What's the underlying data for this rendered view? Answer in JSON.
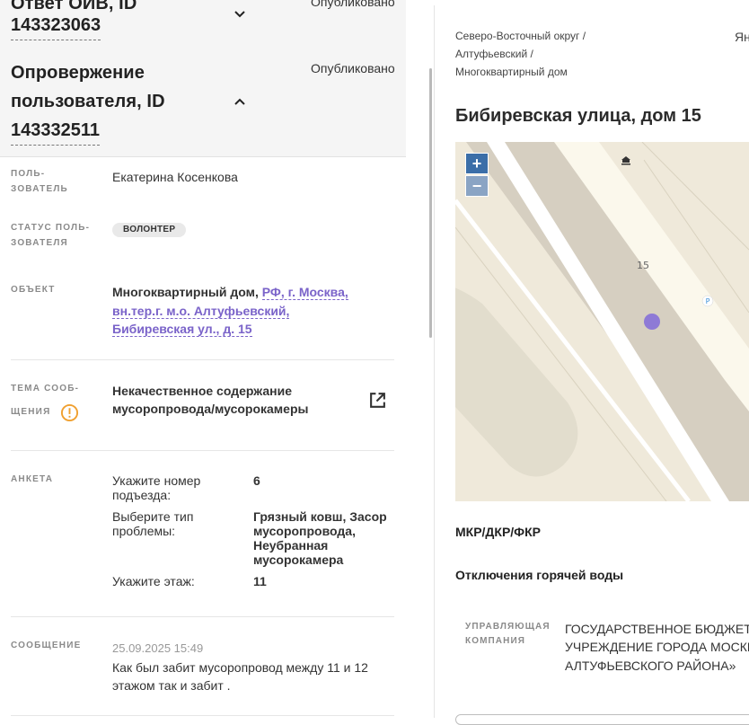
{
  "header": {
    "prev_title": "Ответ ОИВ, ID",
    "prev_id": "143323063",
    "prev_status": "Опубликовано",
    "current_title_line1": "Опровержение",
    "current_title_line2": "пользователя, ID",
    "current_id": "143332511",
    "current_status": "Опубликовано"
  },
  "details": {
    "user_label_1": "ПОЛЬ-",
    "user_label_2": "ЗОВАТЕЛЬ",
    "user_value": "Екатерина Косенкова",
    "status_label_1": "СТАТУС ПОЛЬ-",
    "status_label_2": "ЗОВАТЕЛЯ",
    "status_badge": "ВОЛОНТЕР",
    "object_label": "ОБЪЕКТ",
    "object_type": "Многоквартирный дом,",
    "object_addr_1": "РФ, г. Москва,",
    "object_addr_2": "вн.тер.г. м.о. Алтуфьевский,",
    "object_addr_3": "Бибиревская ул., д. 15",
    "topic_label_1": "ТЕМА СООБ-",
    "topic_label_2": "ЩЕНИЯ",
    "topic_value_1": "Некачественное содержание",
    "topic_value_2": "мусоропровода/мусорокамеры",
    "survey_label": "АНКЕТА",
    "survey": [
      {
        "q1": "Укажите номер",
        "q2": "подъезда:",
        "a1": "6",
        "a2": "",
        "a3": "",
        "a4": ""
      },
      {
        "q1": "Выберите тип",
        "q2": "проблемы:",
        "a1": "Грязный ковш, Засор",
        "a2": "мусоропровода,",
        "a3": "Неубранная",
        "a4": "мусорокамера"
      },
      {
        "q1": "Укажите этаж:",
        "q2": "",
        "a1": "11",
        "a2": "",
        "a3": "",
        "a4": ""
      }
    ],
    "message_label": "СООБЩЕНИЕ",
    "message_date": "25.09.2025 15:49",
    "message_line1": "Как был забит мусоропровод между 11 и 12",
    "message_line2": "этажом так и забит ."
  },
  "right": {
    "crumb1": "Северо-Восточный округ /",
    "crumb2": "Алтуфьевский /",
    "crumb3": "Многоквартирный дом",
    "cut_text": "Ян",
    "title": "Бибиревская улица, дом 15",
    "map_house_number": "15",
    "map_parking": "P",
    "zoom_in": "+",
    "zoom_out": "−",
    "section1": "МКР/ДКР/ФКР",
    "section2": "Отключения горячей воды",
    "org_label_1": "УПРАВЛЯЮЩАЯ",
    "org_label_2": "КОМПАНИЯ",
    "org_line1": "ГОСУДАРСТВЕННОЕ БЮДЖЕТНО",
    "org_line2": "УЧРЕЖДЕНИЕ ГОРОДА МОСКВЫ",
    "org_line3": "АЛТУФЬЕВСКОГО РАЙОНА»"
  },
  "colors": {
    "accent": "#7a63c9",
    "warning": "#f0a030",
    "map_marker": "#8e7ad6"
  }
}
